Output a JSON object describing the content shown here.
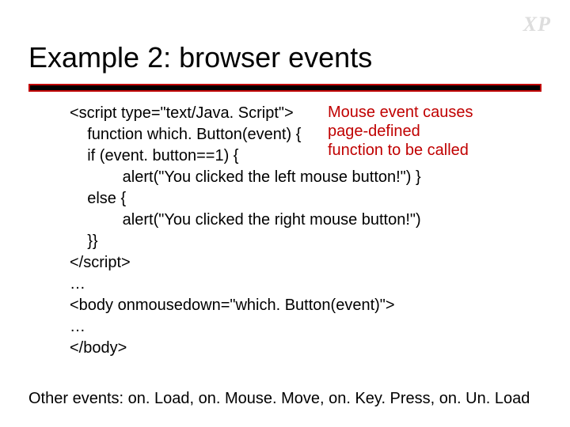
{
  "corner_tag": "XP",
  "title": "Example 2: browser events",
  "callout": {
    "line1": "Mouse event causes",
    "line2": "page-defined",
    "line3": "function to be called"
  },
  "code": {
    "l1": "<script type=\"text/Java. Script\">",
    "l2": "    function which. Button(event) {",
    "l3": "    if (event. button==1) {",
    "l4": "            alert(\"You clicked the left mouse button!\") }",
    "l5": "    else {",
    "l6": "            alert(\"You clicked the right mouse button!\")",
    "l7": "    }}",
    "l8": "</script>",
    "l9": "…",
    "l10": "<body onmousedown=\"which. Button(event)\">",
    "l11": "…",
    "l12": "</body>"
  },
  "footer": "Other events: on. Load, on. Mouse. Move, on. Key. Press, on. Un. Load"
}
